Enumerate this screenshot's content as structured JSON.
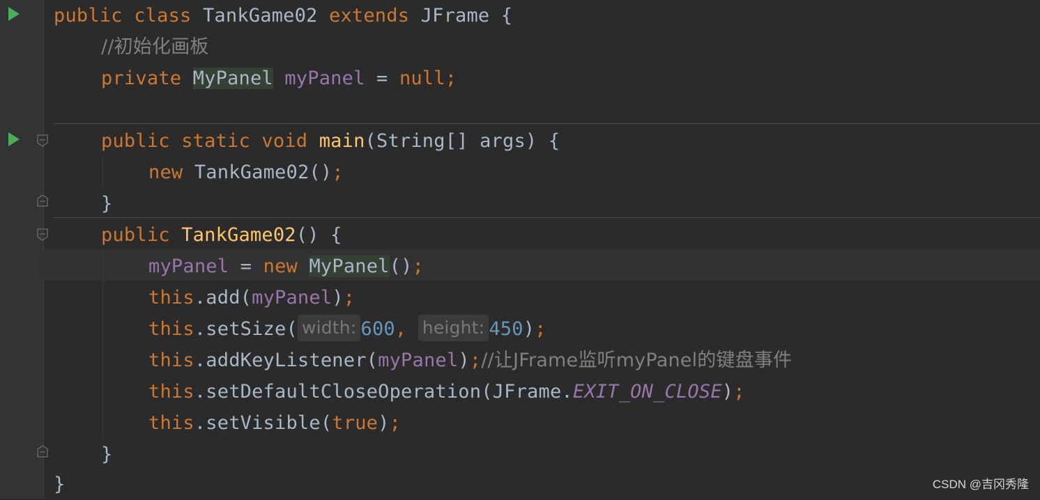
{
  "editor": {
    "language": "Java",
    "colors": {
      "background": "#2b2b2b",
      "keyword": "#cc7832",
      "method": "#ffc66d",
      "field": "#9876aa",
      "number": "#6897bb",
      "comment": "#808080",
      "text": "#a9b7c6"
    },
    "lines": [
      {
        "tokens": [
          "public",
          "class",
          "TankGame02",
          "extends",
          "JFrame",
          "{"
        ]
      },
      {
        "tokens": [
          "//初始化画板"
        ]
      },
      {
        "tokens": [
          "private",
          "MyPanel",
          "myPanel",
          "=",
          "null",
          ";"
        ]
      },
      {
        "tokens": []
      },
      {
        "tokens": [
          "public",
          "static",
          "void",
          "main",
          "(String[] args)",
          "{"
        ]
      },
      {
        "tokens": [
          "new",
          "TankGame02()",
          ";"
        ]
      },
      {
        "tokens": [
          "}"
        ]
      },
      {
        "tokens": [
          "public",
          "TankGame02",
          "()",
          "{"
        ]
      },
      {
        "tokens": [
          "myPanel",
          "=",
          "new",
          "MyPanel",
          "()",
          ";"
        ]
      },
      {
        "tokens": [
          "this",
          ".add(",
          "myPanel",
          ")",
          ";"
        ]
      },
      {
        "tokens": [
          "this",
          ".setSize(",
          "width:",
          "600",
          ",",
          "height:",
          "450",
          ")",
          ";"
        ]
      },
      {
        "tokens": [
          "this",
          ".addKeyListener(",
          "myPanel",
          ")",
          ";",
          "//让JFrame监听myPanel的键盘事件"
        ]
      },
      {
        "tokens": [
          "this",
          ".setDefaultCloseOperation(JFrame.",
          "EXIT_ON_CLOSE",
          ")",
          ";"
        ]
      },
      {
        "tokens": [
          "this",
          ".setVisible(",
          "true",
          ")",
          ";"
        ]
      },
      {
        "tokens": [
          "}"
        ]
      },
      {
        "tokens": [
          "}"
        ]
      }
    ]
  },
  "gutter_icons": [
    "run-icon-class",
    "run-icon-main",
    "fold-icon-main-start",
    "fold-icon-main-end",
    "fold-icon-ctor-start",
    "fold-icon-ctor-end"
  ],
  "watermark": "CSDN @吉冈秀隆"
}
